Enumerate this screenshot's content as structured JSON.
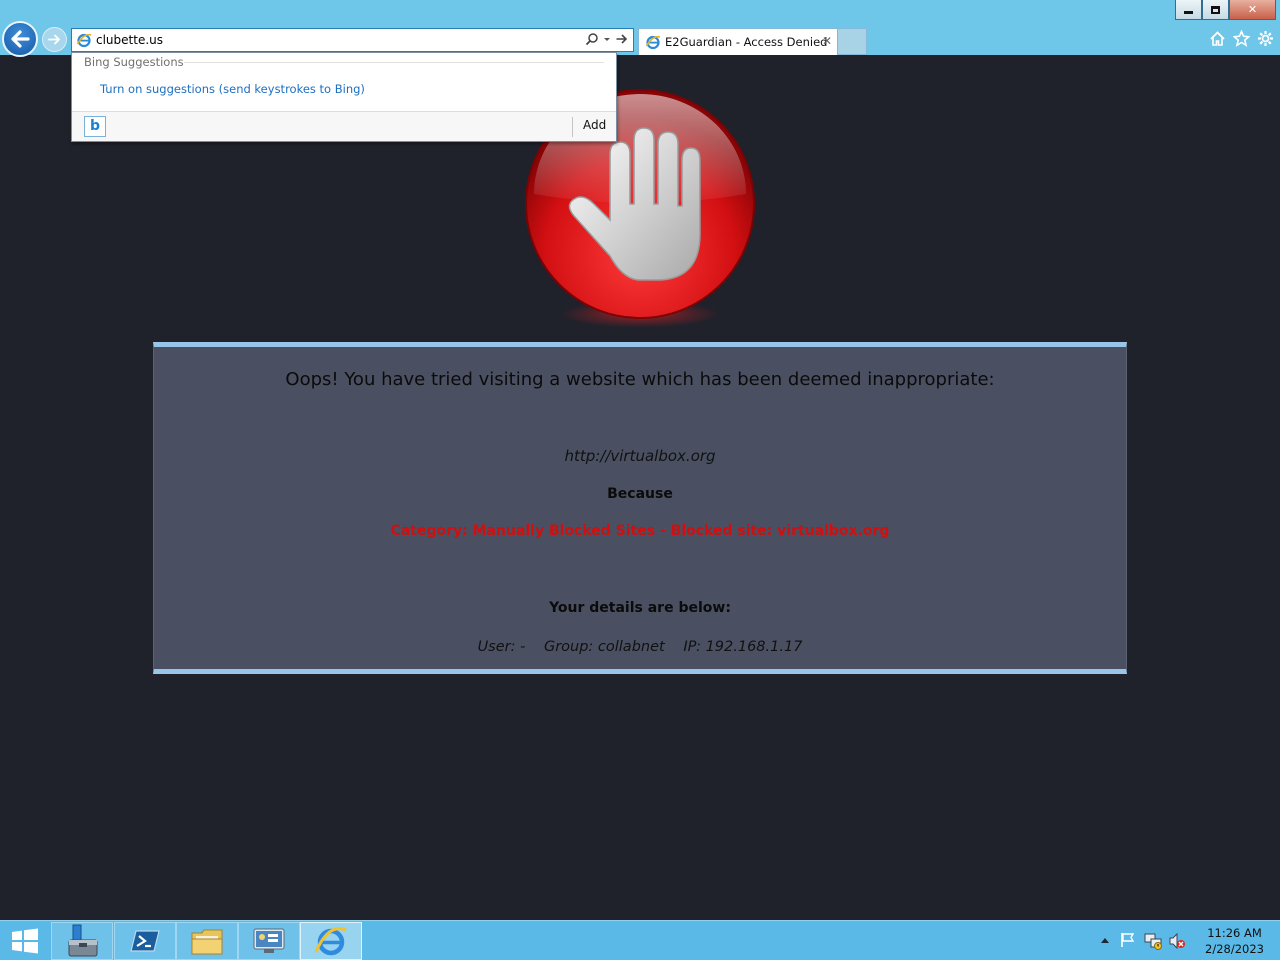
{
  "browser": {
    "address_value": "clubette.us",
    "tab_title": "E2Guardian - Access Denied",
    "tab_close": "✕",
    "window_controls": {
      "close": "✕"
    },
    "icons": [
      "back-arrow-icon",
      "forward-arrow-icon",
      "ie-page-icon",
      "search-icon",
      "dropdown-icon",
      "go-arrow-icon",
      "home-icon",
      "favorites-star-icon",
      "settings-gear-icon"
    ]
  },
  "suggestions": {
    "heading": "Bing Suggestions",
    "link": "Turn on suggestions (send keystrokes to Bing)",
    "bing_button": "b",
    "add_label": "Add"
  },
  "page": {
    "headline": "Oops! You have tried visiting a website which has been deemed inappropriate:",
    "blocked_url": "http://virtualbox.org",
    "because_label": "Because",
    "reason": "Category: Manually Blocked Sites - Blocked site: virtualbox.org",
    "details_heading": "Your details are below:",
    "user": "User: -",
    "group": "Group: collabnet",
    "ip": "IP: 192.168.1.17",
    "colors": {
      "panel": "#4a5061",
      "panel_border": "#99c6e8",
      "reason": "#d10f0f",
      "background": "#1f212b"
    }
  },
  "taskbar": {
    "items": [
      "start-windows-icon",
      "server-manager-icon",
      "powershell-icon",
      "file-explorer-icon",
      "control-panel-icon",
      "internet-explorer-icon"
    ],
    "tray_icons": [
      "show-hidden-icons",
      "action-center-flag-icon",
      "network-icon",
      "volume-muted-icon"
    ],
    "time": "11:26 AM",
    "date": "2/28/2023",
    "accent": "#5ab9e6"
  }
}
